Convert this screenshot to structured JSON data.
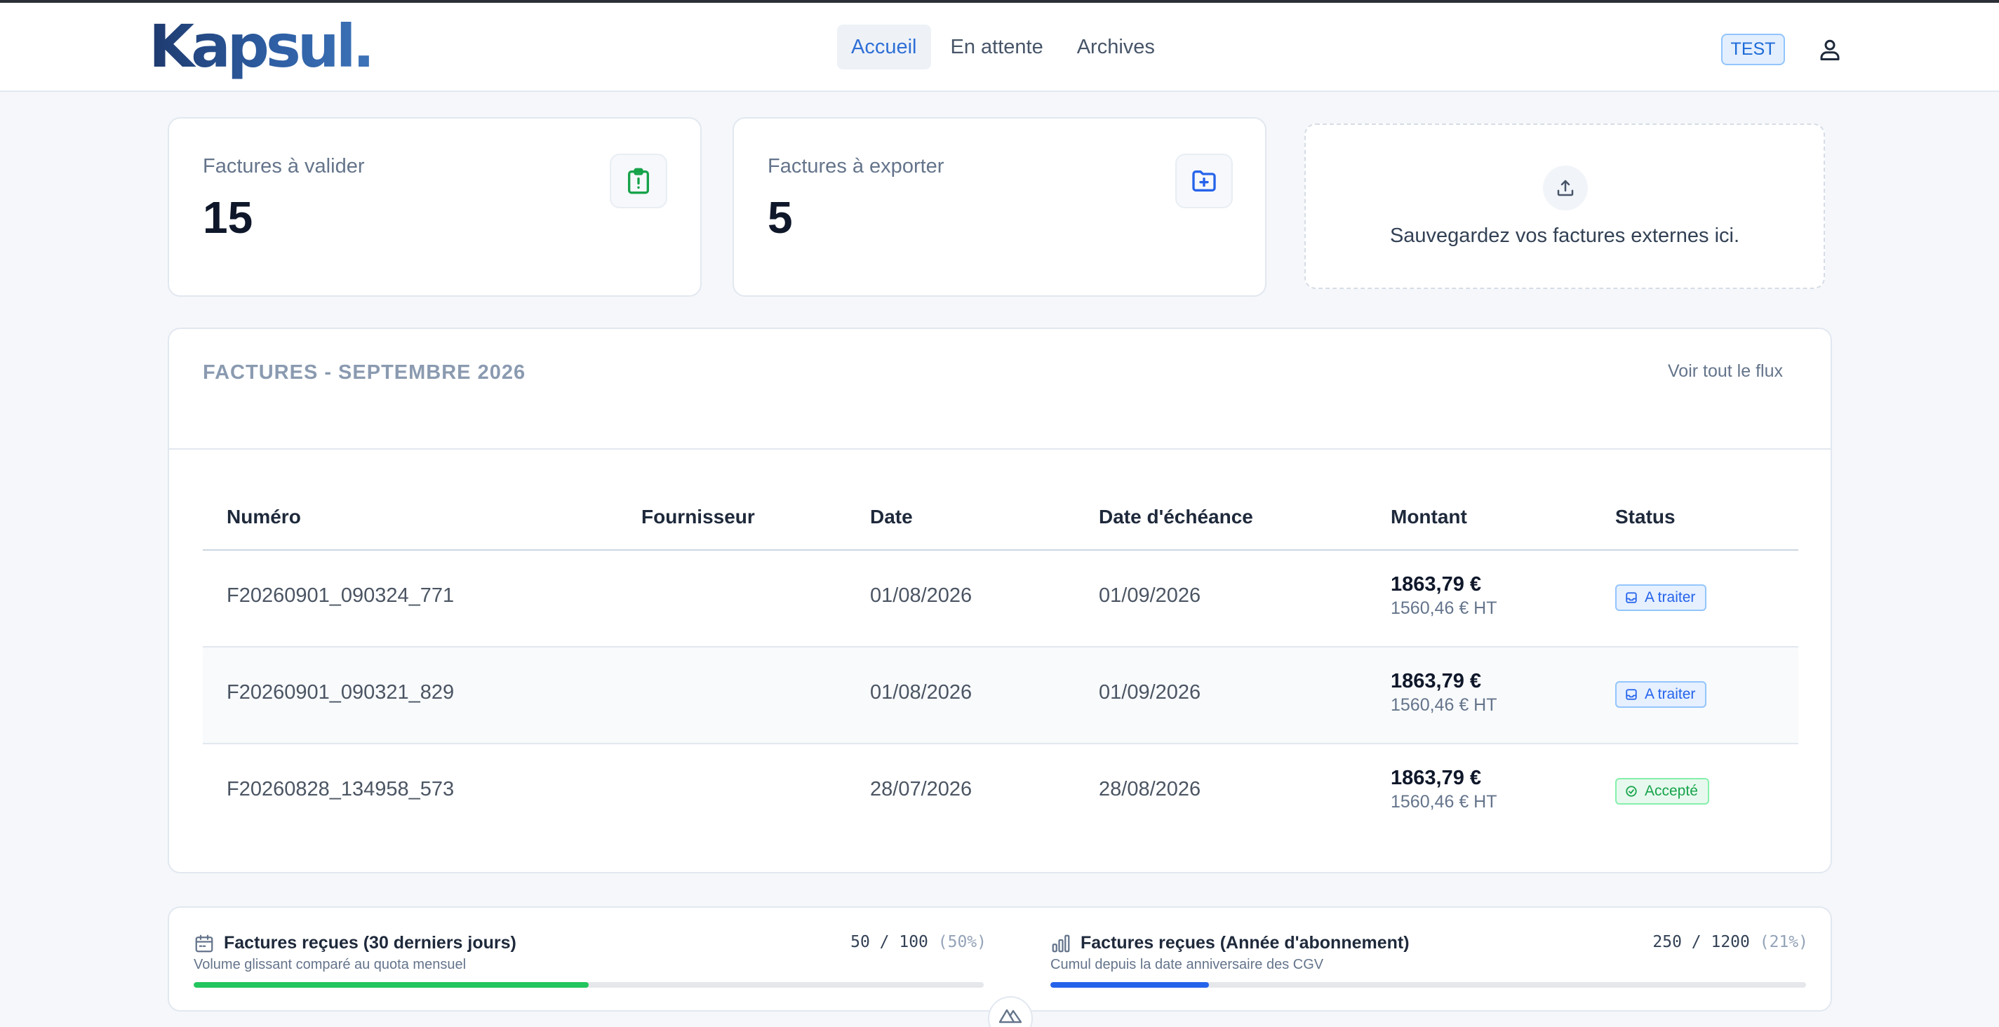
{
  "header": {
    "logo": "Kapsul.",
    "nav": [
      {
        "label": "Accueil",
        "active": true
      },
      {
        "label": "En attente",
        "active": false
      },
      {
        "label": "Archives",
        "active": false
      }
    ],
    "env_badge": "TEST",
    "user_icon": "user-icon"
  },
  "stats": {
    "to_validate": {
      "label": "Factures à valider",
      "value": "15",
      "icon": "clipboard-alert-icon",
      "color": "#16a34a"
    },
    "to_export": {
      "label": "Factures à exporter",
      "value": "5",
      "icon": "folder-plus-icon",
      "color": "#2563eb"
    }
  },
  "upload": {
    "text": "Sauvegardez vos factures externes ici.",
    "icon": "upload-icon"
  },
  "invoices": {
    "title": "FACTURES - SEPTEMBRE 2026",
    "see_all": "Voir tout le flux",
    "columns": {
      "number": "Numéro",
      "supplier": "Fournisseur",
      "date": "Date",
      "due_date": "Date d'échéance",
      "amount": "Montant",
      "status": "Status"
    },
    "rows": [
      {
        "number": "F20260901_090324_771",
        "supplier": "",
        "date": "01/08/2026",
        "due_date": "01/09/2026",
        "amount": "1863,79 €",
        "amount_ht": "1560,46 € HT",
        "status": "A traiter",
        "status_type": "todo",
        "status_icon": "inbox-icon"
      },
      {
        "number": "F20260901_090321_829",
        "supplier": "",
        "date": "01/08/2026",
        "due_date": "01/09/2026",
        "amount": "1863,79 €",
        "amount_ht": "1560,46 € HT",
        "status": "A traiter",
        "status_type": "todo",
        "status_icon": "inbox-icon"
      },
      {
        "number": "F20260828_134958_573",
        "supplier": "",
        "date": "28/07/2026",
        "due_date": "28/08/2026",
        "amount": "1863,79 €",
        "amount_ht": "1560,46 € HT",
        "status": "Accepté",
        "status_type": "ok",
        "status_icon": "check-circle-icon"
      }
    ]
  },
  "quotas": {
    "monthly": {
      "title": "Factures reçues (30 derniers jours)",
      "subtitle": "Volume glissant comparé au quota mensuel",
      "count": "50 / 100",
      "percent_label": "(50%)",
      "fill_fraction": 0.5,
      "color": "#22c55e",
      "icon": "calendar-icon"
    },
    "yearly": {
      "title": "Factures reçues (Année d'abonnement)",
      "subtitle": "Cumul depuis la date anniversaire des CGV",
      "count": "250 / 1200",
      "percent_label": "(21%)",
      "fill_fraction": 0.21,
      "color": "#2563eb",
      "icon": "bar-chart-icon"
    }
  },
  "devtools_icon": "nuxt-devtools-icon"
}
